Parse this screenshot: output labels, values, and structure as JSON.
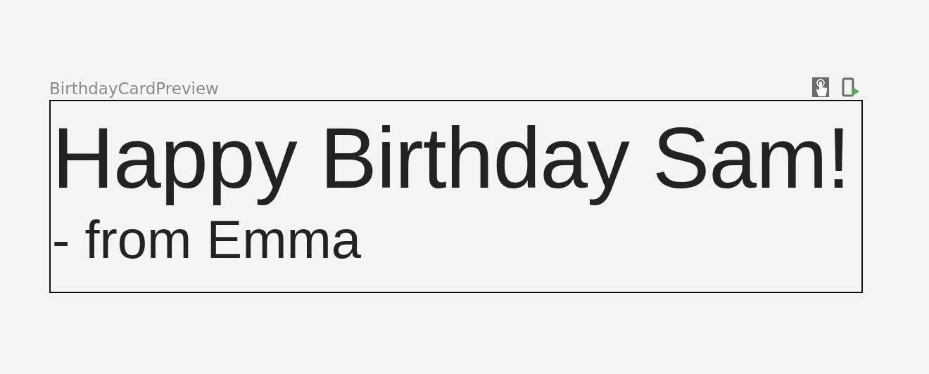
{
  "preview": {
    "title": "BirthdayCardPreview"
  },
  "card": {
    "greeting": "Happy Birthday Sam!",
    "signature": "- from Emma"
  }
}
